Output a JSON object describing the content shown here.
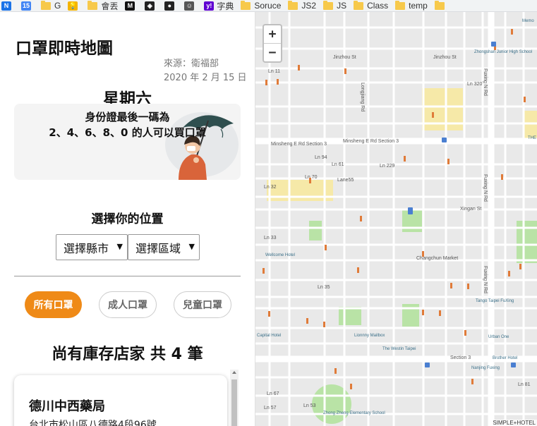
{
  "bookmarks": [
    {
      "type": "icon",
      "label": "",
      "icon": "n-icon",
      "color": "#1a73e8",
      "glyph": "N"
    },
    {
      "type": "icon",
      "label": "",
      "icon": "calendar-icon",
      "color": "#4285f4",
      "glyph": "15"
    },
    {
      "type": "folder",
      "label": "G"
    },
    {
      "type": "icon",
      "label": "",
      "icon": "bulb-icon",
      "color": "#f4b400",
      "glyph": "💡"
    },
    {
      "type": "folder",
      "label": "會丟"
    },
    {
      "type": "icon",
      "label": "",
      "icon": "medium-icon",
      "color": "#111",
      "glyph": "M"
    },
    {
      "type": "icon",
      "label": "",
      "icon": "codepen-icon",
      "color": "#222",
      "glyph": "◈"
    },
    {
      "type": "icon",
      "label": "",
      "icon": "github-icon",
      "color": "#222",
      "glyph": "●"
    },
    {
      "type": "icon",
      "label": "",
      "icon": "avatar-icon",
      "color": "#555",
      "glyph": "☺"
    },
    {
      "type": "iconlabel",
      "label": "字典",
      "icon": "yahoo-icon",
      "color": "#6001d2",
      "glyph": "y!"
    },
    {
      "type": "folder",
      "label": "Soruce"
    },
    {
      "type": "folder",
      "label": "JS2"
    },
    {
      "type": "folder",
      "label": "JS"
    },
    {
      "type": "folder",
      "label": "Class"
    },
    {
      "type": "folder",
      "label": "temp"
    },
    {
      "type": "folder",
      "label": ""
    }
  ],
  "sidebar": {
    "title": "口罩即時地圖",
    "source": "來源：衛福部",
    "date": "2020 年 2 月 15 日",
    "weekday": "星期六",
    "rule_line1": "身份證最後一碼為",
    "rule_line2": "2、4、6、8、0 的人可以買口罩",
    "location_title": "選擇你的位置",
    "county_select": "選擇縣市",
    "district_select": "選擇區域",
    "filters": [
      "所有口罩",
      "成人口罩",
      "兒童口罩"
    ],
    "stock_title": "尚有庫存店家 共 4 筆",
    "store": {
      "name": "德川中西藥局",
      "address": "台北市松山區八德路4段96號"
    }
  },
  "map": {
    "zoom_in": "+",
    "zoom_out": "−",
    "attribution": "SIMPLE+HOTEL",
    "road_labels": [
      "Jinzhou St",
      "Jinzhou St",
      "Minsheng E Rd Section 3",
      "Minsheng E Rd Section 3",
      "Xingan St",
      "Changchun Market",
      "Section 3",
      "Fuxing N Rd",
      "Fuxing N Rd",
      "Fuxing N Rd",
      "Longjiang Rd",
      "Lane55",
      "Ln 70",
      "Ln 94",
      "Ln 61",
      "Ln 229",
      "Ln 33",
      "Ln 67",
      "Ln 81",
      "Ln 35",
      "Ln 32",
      "Ln 11",
      "Ln 53",
      "Ln 57",
      "Ln 320"
    ],
    "place_labels": [
      "Zhongshan Junior High School",
      "Wellcome Hotel",
      "Tango Taipei FuXing",
      "Urban One",
      "Brother Hotel",
      "Nanjing Fuxing",
      "The Westin Taipei",
      "Zhong Zheng Elementary School",
      "Capital Hotel",
      "Lionnny Mailbox",
      "Memo",
      "THE"
    ],
    "colors": {
      "road": "#ffffff",
      "block": "#e9e9e9",
      "park": "#b9e3a6",
      "highlight": "#f6e9a8",
      "poi": "#e07b39"
    }
  }
}
